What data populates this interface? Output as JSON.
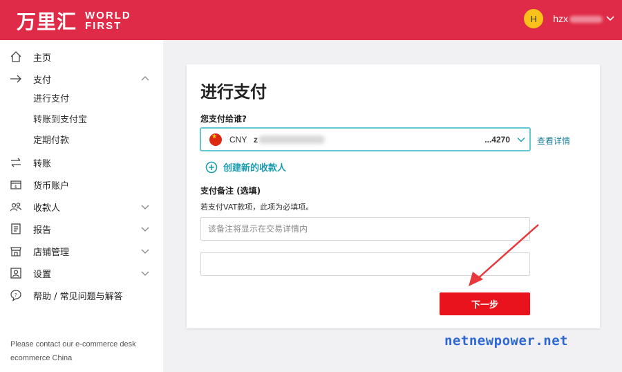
{
  "brand": {
    "logo_cn": "万里汇",
    "logo_en_line1": "WORLD",
    "logo_en_line2": "FIRST",
    "color": "#e02b48"
  },
  "user": {
    "avatar_initial": "H",
    "name_visible": "hzx",
    "chevron_icon": "chevron-down-icon"
  },
  "sidebar": {
    "items": [
      {
        "label": "主页",
        "icon": "home-icon"
      },
      {
        "label": "支付",
        "icon": "arrow-right-icon",
        "expanded": true
      },
      {
        "label": "转账",
        "icon": "transfer-icon"
      },
      {
        "label": "货币账户",
        "icon": "wallet-icon"
      },
      {
        "label": "收款人",
        "icon": "users-icon"
      },
      {
        "label": "报告",
        "icon": "report-icon"
      },
      {
        "label": "店铺管理",
        "icon": "store-icon"
      },
      {
        "label": "设置",
        "icon": "settings-icon"
      },
      {
        "label": "帮助 / 常见问题与解答",
        "icon": "help-icon"
      }
    ],
    "pay_subitems": [
      "进行支付",
      "转账到支付宝",
      "定期付款"
    ],
    "footer_line1": "Please contact our e-commerce desk",
    "footer_line2": "ecommerce China"
  },
  "form": {
    "title": "进行支付",
    "payee_label": "您支付给谁?",
    "payee": {
      "currency": "CNY",
      "name_prefix": "z",
      "account_suffix": "...4270"
    },
    "details_link": "查看详情",
    "create_payee": "创建新的收款人",
    "remark_label": "支付备注 (选填)",
    "remark_hint": "若支付VAT款项，此项为必填项。",
    "remark_placeholder": "该备注将显示在交易详情内",
    "second_input_value": "",
    "next_button": "下一步"
  },
  "watermark": "netnewpower.net",
  "colors": {
    "accent_teal": "#62c7d3",
    "link": "#1b7f96",
    "button_red": "#e8131c",
    "annotation_arrow": "#e8383d"
  }
}
